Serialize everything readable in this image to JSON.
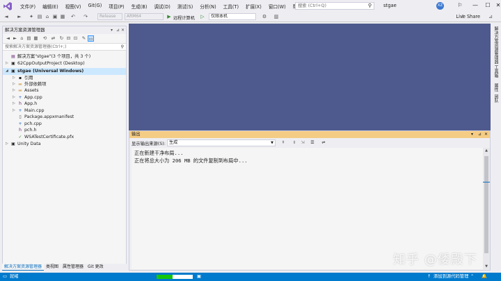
{
  "menu": {
    "items": [
      "文件(F)",
      "编辑(E)",
      "视图(V)",
      "Git(G)",
      "项目(P)",
      "生成(B)",
      "调试(D)",
      "测试(S)",
      "分析(N)",
      "工具(T)",
      "扩展(X)",
      "窗口(W)",
      "帮助(H)"
    ],
    "search_placeholder": "搜索 (Ctrl+Q)",
    "solution_name": "stgae",
    "avatar_initials": "XZ",
    "minimize": "—",
    "maximize": "☐",
    "close": "✕"
  },
  "toolbar": {
    "config": "Release",
    "platform": "ARM64",
    "target": "远程计算机",
    "scope": "仅限本机",
    "live_share": "Live Share"
  },
  "solution_explorer": {
    "title": "解决方案资源管理器",
    "search_placeholder": "搜索解决方案资源管理器(Ctrl+;)",
    "tree": [
      {
        "label": "解决方案\"stgae\"(3 个项目，共 3 个)",
        "level": 0,
        "icon": "solution-icon"
      },
      {
        "label": "62CppOutputProject (Desktop)",
        "level": 0,
        "icon": "project-icon"
      },
      {
        "label": "stgae (Universal Windows)",
        "level": 0,
        "icon": "project-icon",
        "selected": true
      },
      {
        "label": "引用",
        "level": 1,
        "icon": "references-icon"
      },
      {
        "label": "外部依赖项",
        "level": 1,
        "icon": "folder-icon"
      },
      {
        "label": "Assets",
        "level": 1,
        "icon": "folder-icon"
      },
      {
        "label": "App.cpp",
        "level": 1,
        "icon": "cpp-file-icon"
      },
      {
        "label": "App.h",
        "level": 1,
        "icon": "header-file-icon"
      },
      {
        "label": "Main.cpp",
        "level": 1,
        "icon": "cpp-file-icon"
      },
      {
        "label": "Package.appxmanifest",
        "level": 1,
        "icon": "manifest-icon"
      },
      {
        "label": "pch.cpp",
        "level": 1,
        "icon": "cpp-file-icon"
      },
      {
        "label": "pch.h",
        "level": 1,
        "icon": "header-file-icon"
      },
      {
        "label": "WSATestCertificate.pfx",
        "level": 1,
        "icon": "certificate-icon"
      },
      {
        "label": "Unity Data",
        "level": 0,
        "icon": "project-icon"
      }
    ],
    "tabs": [
      "解决方案资源管理器",
      "类视图",
      "属性管理器",
      "Git 更改"
    ]
  },
  "right_dock": {
    "tabs": [
      "解决方案资源管理器",
      "工具箱",
      "属性",
      "团队"
    ]
  },
  "output": {
    "title": "输出",
    "source_label": "显示输出来源(S):",
    "source_value": "生成",
    "lines": [
      "正在新建干净布局...",
      "正在将总大小为 206 MB 的文件复制到布局中..."
    ]
  },
  "status": {
    "text": "就绪",
    "progress": 0.45,
    "source_control": "添加到源代码管理"
  },
  "watermark": "知乎 @倭殿下"
}
